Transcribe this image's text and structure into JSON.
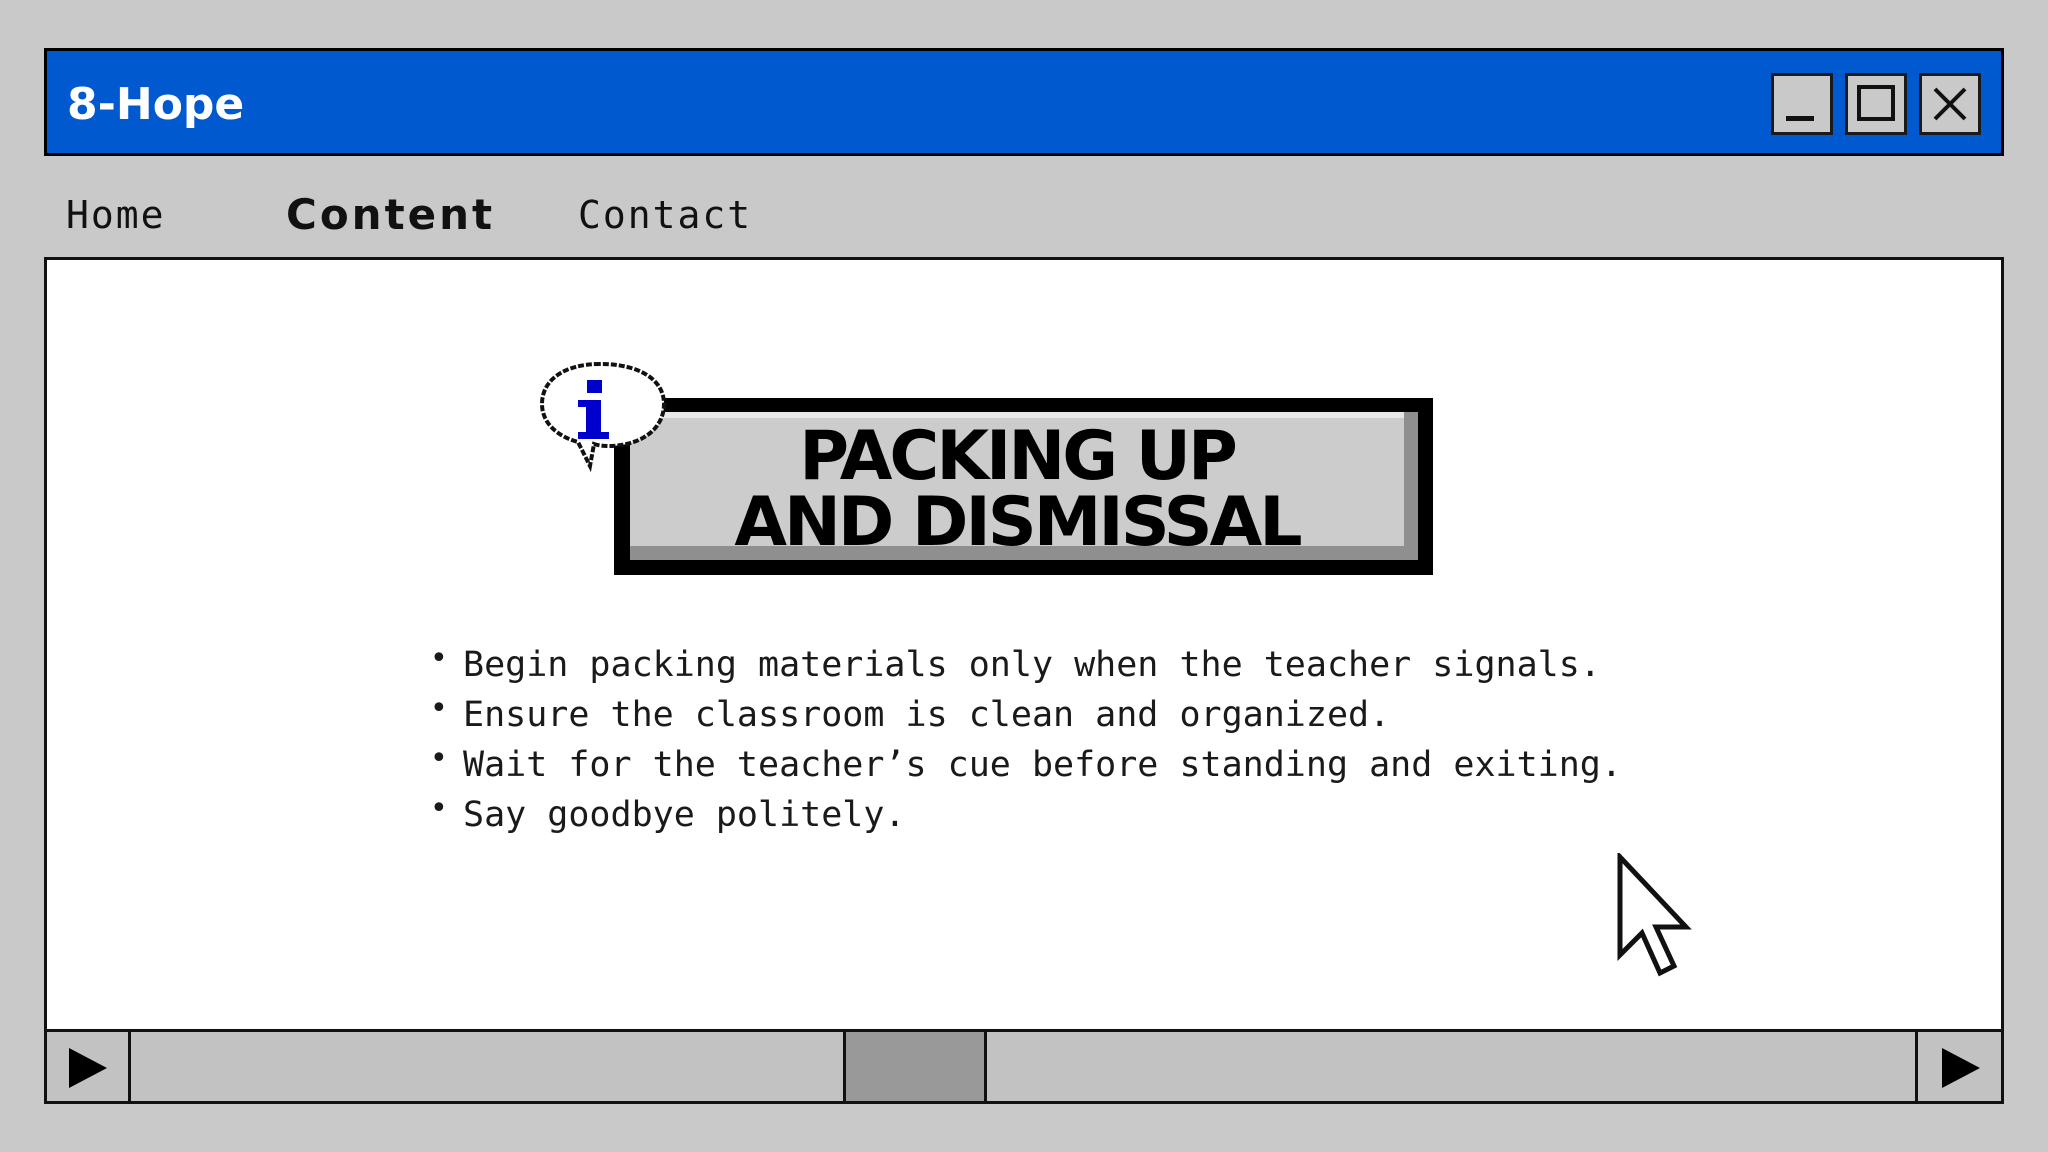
{
  "window": {
    "title": "8-Hope",
    "titlebar_color": "#0059cf",
    "controls": {
      "minimize_icon": "minimize-icon",
      "maximize_icon": "maximize-icon",
      "close_icon": "close-icon"
    }
  },
  "menu": {
    "items": [
      {
        "label": "Home",
        "active": false
      },
      {
        "label": "Content",
        "active": true
      },
      {
        "label": "Contact",
        "active": false
      }
    ]
  },
  "main": {
    "icon": "info-icon",
    "icon_color": "#0000cc",
    "heading_line1": "PACKING UP",
    "heading_line2": "AND DISMISSAL",
    "bullets": [
      "Begin packing materials only when the teacher signals.",
      "Ensure the classroom is clean and organized.",
      "Wait for the teacher’s cue before standing and exiting.",
      "Say goodbye politely."
    ]
  },
  "scrollbar": {
    "left_icon": "play-right-icon",
    "right_icon": "play-right-icon"
  }
}
